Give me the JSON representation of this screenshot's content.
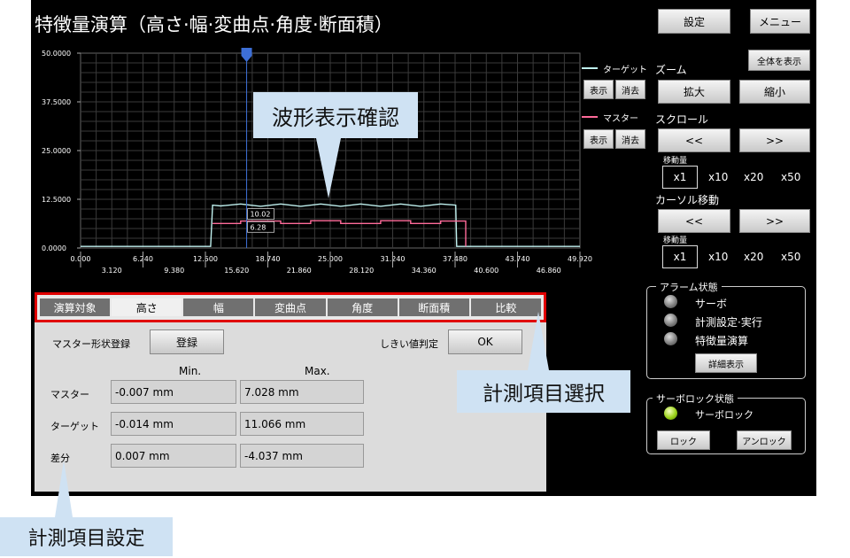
{
  "title": "特徴量演算（高さ·幅·変曲点·角度·断面積）",
  "header": {
    "settings_label": "設定",
    "menu_label": "メニュー"
  },
  "legend": {
    "target_label": "ターゲット",
    "master_label": "マスター",
    "show_label": "表示",
    "hide_label": "消去",
    "target_color": "#bff0ee",
    "master_color": "#ff6b9a"
  },
  "chart_data": {
    "type": "line",
    "title": "",
    "xlabel": "",
    "ylabel": "",
    "xlim": [
      0,
      49.92
    ],
    "ylim": [
      0,
      50
    ],
    "y_ticks": [
      "50.0000",
      "37.5000",
      "25.0000",
      "12.5000",
      "0.0000"
    ],
    "x_ticks_top": [
      "0.000",
      "6.240",
      "12.500",
      "18.740",
      "25.000",
      "31.240",
      "37.480",
      "43.740",
      "49.920"
    ],
    "x_ticks_bottom": [
      "3.120",
      "9.380",
      "15.620",
      "21.860",
      "28.120",
      "34.360",
      "40.600",
      "46.860"
    ],
    "grid": true,
    "cursor_x": 16.6,
    "annotations": [
      "10.02",
      "6.28"
    ],
    "series": [
      {
        "name": "ターゲット",
        "x": [
          0,
          13.0,
          13.2,
          14,
          16,
          18,
          20,
          22,
          24,
          26,
          28,
          30,
          32,
          34,
          36,
          37.5,
          37.6,
          49.92
        ],
        "values": [
          0.4,
          0.4,
          11.0,
          10.8,
          11.3,
          10.7,
          11.3,
          10.7,
          11.3,
          10.7,
          11.3,
          10.7,
          11.3,
          10.7,
          11.3,
          11.0,
          0.4,
          0.4
        ]
      },
      {
        "name": "マスター",
        "x": [
          13.2,
          16,
          16,
          20,
          20,
          23,
          23,
          26,
          26,
          30,
          30,
          33,
          33,
          36,
          36,
          38.5,
          38.5
        ],
        "values": [
          6.3,
          6.3,
          6.9,
          6.9,
          6.3,
          6.3,
          7.0,
          7.0,
          6.3,
          6.3,
          7.0,
          7.0,
          6.3,
          6.3,
          6.9,
          6.9,
          0.4
        ]
      }
    ]
  },
  "view": {
    "show_all_label": "全体を表示",
    "zoom_label": "ズーム",
    "zoom_in_label": "拡大",
    "zoom_out_label": "縮小",
    "scroll_label": "スクロール",
    "left_label": "<<",
    "right_label": ">>",
    "step_label": "移動量",
    "steps": [
      "x1",
      "x10",
      "x20",
      "x50"
    ],
    "cursor_move_label": "カーソル移動"
  },
  "alarm": {
    "title": "アラーム状態",
    "items": [
      "サーボ",
      "計測設定·実行",
      "特徴量演算"
    ],
    "detail_label": "詳細表示"
  },
  "servo_lock": {
    "title": "サーボロック状態",
    "item": "サーボロック",
    "lock_label": "ロック",
    "unlock_label": "アンロック"
  },
  "tabs": [
    "演算対象",
    "高さ",
    "幅",
    "変曲点",
    "角度",
    "断面積",
    "比較"
  ],
  "panel": {
    "master_register_label": "マスター形状登録",
    "register_label": "登録",
    "threshold_label": "しきい値判定",
    "threshold_value": "OK",
    "min_label": "Min.",
    "max_label": "Max.",
    "rows": [
      {
        "label": "マスター",
        "min": "-0.007 mm",
        "max": "7.028 mm"
      },
      {
        "label": "ターゲット",
        "min": "-0.014 mm",
        "max": "11.066 mm"
      },
      {
        "label": "差分",
        "min": "0.007 mm",
        "max": "-4.037 mm"
      }
    ]
  },
  "callouts": {
    "waveform": "波形表示確認",
    "item_select": "計測項目選択",
    "item_setting": "計測項目設定"
  }
}
